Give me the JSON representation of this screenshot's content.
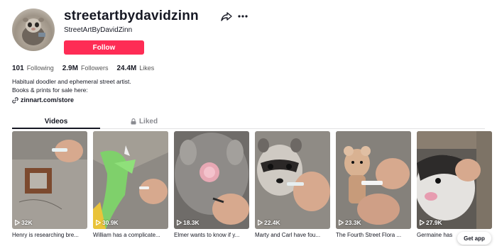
{
  "profile": {
    "username": "streetartbydavidzinn",
    "display_name": "StreetArtByDavidZinn",
    "follow_label": "Follow",
    "avatar_icon": "guinea-pig-avatar"
  },
  "actions": {
    "share_icon": "share-arrow-icon",
    "more_icon": "more-dots-icon"
  },
  "stats": [
    {
      "value": "101",
      "label": "Following"
    },
    {
      "value": "2.9M",
      "label": "Followers"
    },
    {
      "value": "24.4M",
      "label": "Likes"
    }
  ],
  "bio": {
    "line1": "Habitual doodler and ephemeral street artist.",
    "line2": "Books & prints for sale here:"
  },
  "link": {
    "text": "zinnart.com/store",
    "icon": "link-icon"
  },
  "tabs": {
    "videos": "Videos",
    "liked": "Liked",
    "liked_icon": "lock-icon"
  },
  "videos": [
    {
      "views": "32K",
      "caption": "Henry is researching bre..."
    },
    {
      "views": "30.9K",
      "caption": "William has a complicate..."
    },
    {
      "views": "18.3K",
      "caption": "Elmer wants to know if y..."
    },
    {
      "views": "22.4K",
      "caption": "Marty and Carl have fou..."
    },
    {
      "views": "23.3K",
      "caption": "The Fourth Street Flora ..."
    },
    {
      "views": "27.9K",
      "caption": "Germaine has"
    }
  ],
  "get_app": "Get app",
  "colors": {
    "accent": "#fe2c55",
    "text": "#161823",
    "muted": "#8a8b91"
  }
}
